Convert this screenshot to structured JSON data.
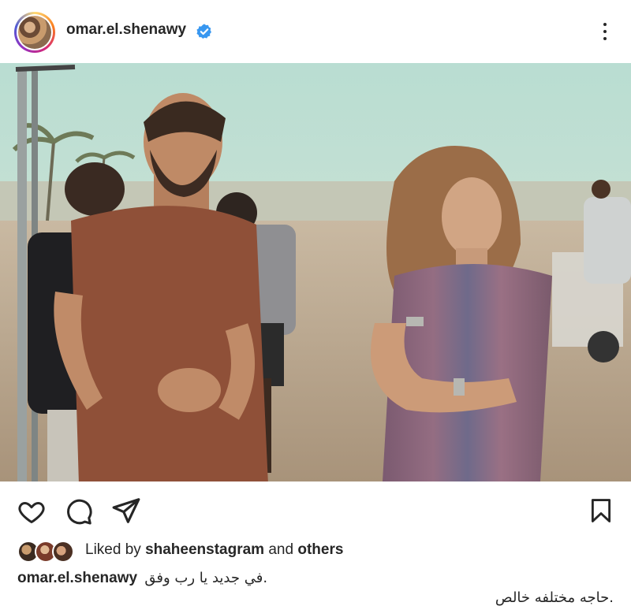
{
  "post": {
    "username": "omar.el.shenawy",
    "verified": true,
    "avatar": "profile-avatar",
    "photo": "movie-set-photo-man-and-woman"
  },
  "actions": {
    "like_icon": "heart-outline-icon",
    "comment_icon": "comment-bubble-icon",
    "share_icon": "paper-plane-icon",
    "save_icon": "bookmark-icon",
    "more_icon": "vertical-ellipsis-icon"
  },
  "likes": {
    "prefix": "Liked by",
    "user": "shaheenstagram",
    "middle": "and",
    "others": "others"
  },
  "caption": {
    "username": "omar.el.shenawy",
    "line1": ".في جديد يا رب وفق",
    "line2": ".حاجه مختلفه خالص"
  },
  "colors": {
    "verified_blue": "#3897f0",
    "text": "#262626"
  }
}
